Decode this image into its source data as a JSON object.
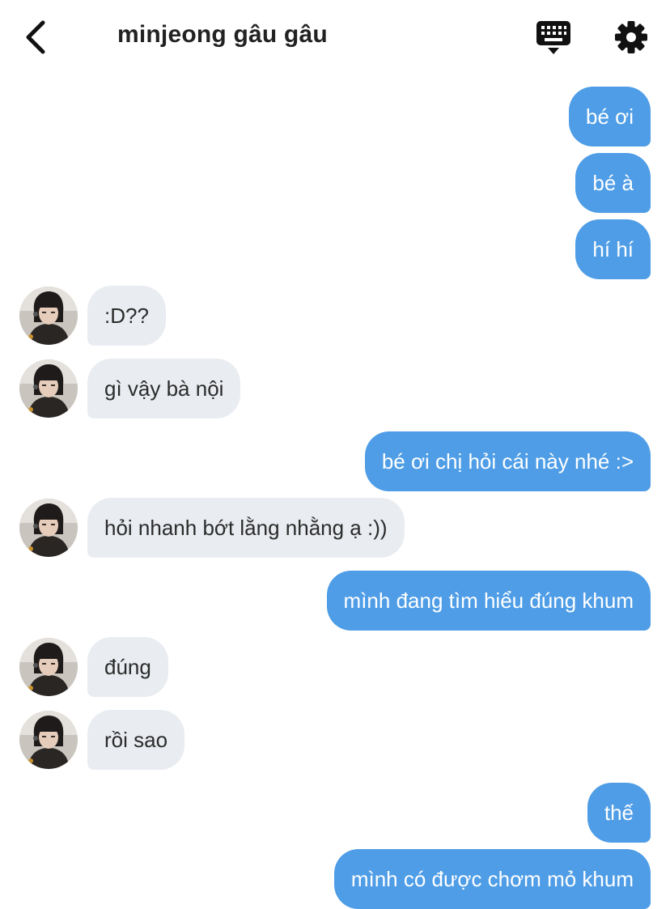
{
  "header": {
    "back_icon": "chevron-left-icon",
    "title": "minjeong gâu gâu",
    "keyboard_icon": "keyboard-icon",
    "settings_icon": "gear-icon"
  },
  "colors": {
    "outgoing_bubble": "#4e9de6",
    "incoming_bubble": "#e9ecf1",
    "header_text": "#222222"
  },
  "messages": [
    {
      "side": "out",
      "text": "bé ơi"
    },
    {
      "side": "out",
      "text": "bé à"
    },
    {
      "side": "out",
      "text": "hí hí"
    },
    {
      "side": "in",
      "text": ":D??"
    },
    {
      "side": "in",
      "text": "gì vậy bà nội"
    },
    {
      "side": "out",
      "text": "bé ơi chị hỏi cái này nhé :>"
    },
    {
      "side": "in",
      "text": "hỏi nhanh bớt lằng nhằng ạ :))"
    },
    {
      "side": "out",
      "text": "mình đang tìm hiểu đúng khum"
    },
    {
      "side": "in",
      "text": "đúng"
    },
    {
      "side": "in",
      "text": "rồi sao"
    },
    {
      "side": "out",
      "text": "thế"
    },
    {
      "side": "out",
      "text": "mình có được chơm mỏ khum"
    }
  ]
}
